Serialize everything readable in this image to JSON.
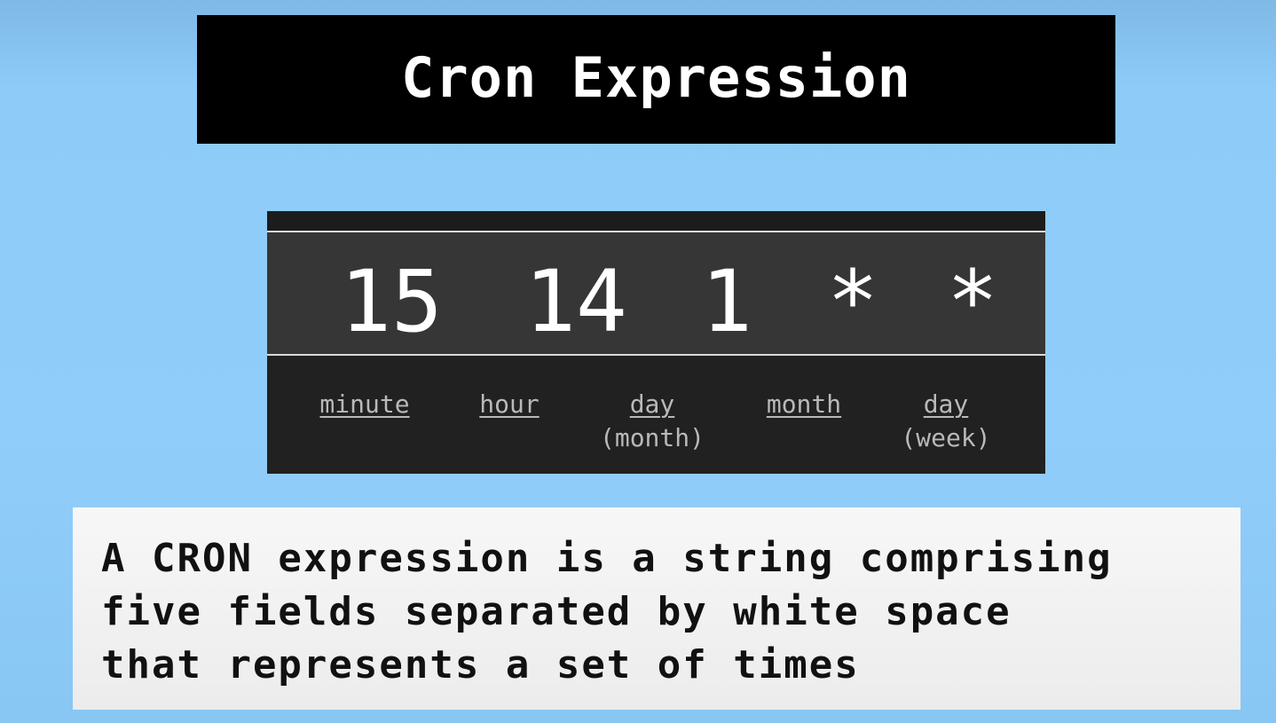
{
  "title": "Cron Expression",
  "cron": {
    "fields": [
      "15",
      "14",
      "1",
      "*",
      "*"
    ],
    "labels": [
      {
        "main": "minute",
        "sub": ""
      },
      {
        "main": "hour",
        "sub": ""
      },
      {
        "main": "day",
        "sub": "(month)"
      },
      {
        "main": "month",
        "sub": ""
      },
      {
        "main": "day",
        "sub": "(week)"
      }
    ]
  },
  "description": {
    "line1": "A CRON expression is a string comprising",
    "line2": "five fields separated by white space",
    "line3": "that represents a set of times"
  }
}
